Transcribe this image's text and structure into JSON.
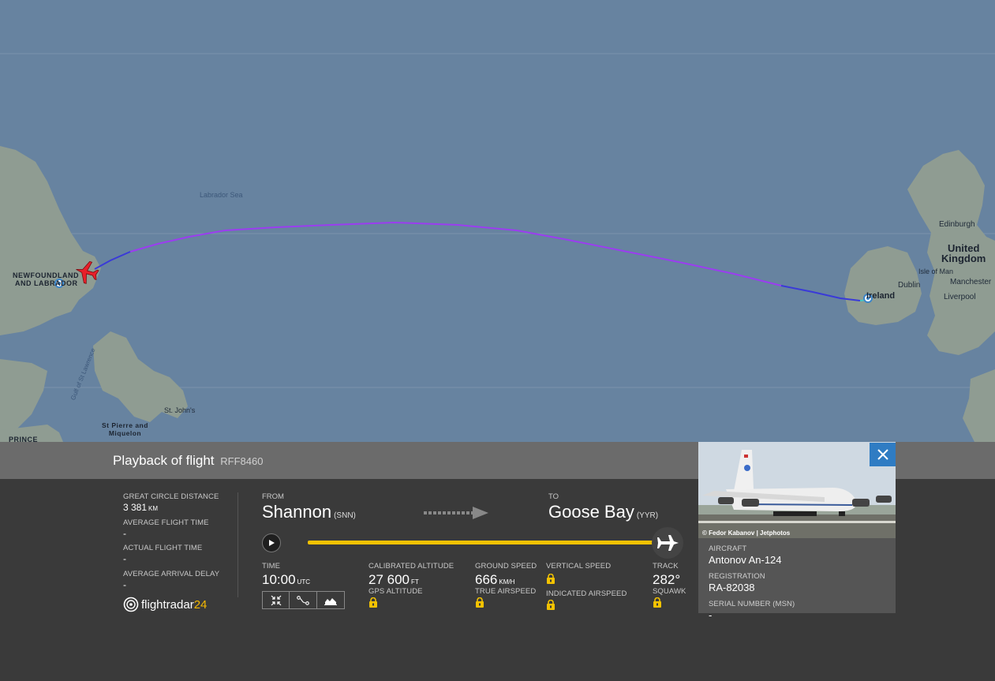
{
  "map": {
    "labels": {
      "labrador_sea": "Labrador Sea",
      "newfoundland": "NEWFOUNDLAND AND LABRADOR",
      "newfoundland_line1": "NEWFOUNDLAND",
      "newfoundland_line2": "AND LABRADOR",
      "gulf": "Gulf of St Lawrence",
      "st_johns": "St. John's",
      "st_pierre_line1": "St Pierre and",
      "st_pierre_line2": "Miquelon",
      "prince": "PRINCE",
      "edinburgh": "Edinburgh",
      "united_kingdom_line1": "United",
      "united_kingdom_line2": "Kingdom",
      "isle_of_man": "Isle of Man",
      "dublin": "Dublin",
      "ireland": "Ireland",
      "manchester": "Manchester",
      "liverpool": "Liverpool"
    },
    "colors": {
      "sea": "#6783a0",
      "land": "#8f9c92",
      "track_main": "#9b3df0",
      "track_descend": "#3a3ad8",
      "aircraft": "#e8202a"
    }
  },
  "panel": {
    "title": "Playback of flight",
    "callsign": "RFF8460",
    "stats": [
      {
        "label": "GREAT CIRCLE DISTANCE",
        "value": "3 381",
        "unit": "KM"
      },
      {
        "label": "AVERAGE FLIGHT TIME",
        "value": "-"
      },
      {
        "label": "ACTUAL FLIGHT TIME",
        "value": "-"
      },
      {
        "label": "AVERAGE ARRIVAL DELAY",
        "value": "-"
      }
    ],
    "logo": {
      "text": "flightradar",
      "num": "24"
    },
    "route": {
      "from_label": "FROM",
      "from_city": "Shannon",
      "from_code": "(SNN)",
      "to_label": "TO",
      "to_city": "Goose Bay",
      "to_code": "(YYR)"
    },
    "playback": {
      "progress": 1.0
    },
    "data": {
      "time": {
        "label": "TIME",
        "value": "10:00",
        "unit": "UTC"
      },
      "calibrated_altitude": {
        "label": "CALIBRATED ALTITUDE",
        "value": "27 600",
        "unit": "FT"
      },
      "gps_altitude": {
        "label": "GPS ALTITUDE"
      },
      "ground_speed": {
        "label": "GROUND SPEED",
        "value": "666",
        "unit": "KM/H"
      },
      "true_airspeed": {
        "label": "TRUE AIRSPEED"
      },
      "vertical_speed": {
        "label": "VERTICAL SPEED"
      },
      "indicated_airspeed": {
        "label": "INDICATED AIRSPEED"
      },
      "track": {
        "label": "TRACK",
        "value": "282°"
      },
      "squawk": {
        "label": "SQUAWK"
      }
    },
    "aircraft": {
      "photo_credit": "© Fedor Kabanov | Jetphotos",
      "aircraft_label": "AIRCRAFT",
      "aircraft_value": "Antonov An-124",
      "registration_label": "REGISTRATION",
      "registration_value": "RA-82038",
      "serial_label": "SERIAL NUMBER (MSN)",
      "serial_value": "-"
    }
  }
}
